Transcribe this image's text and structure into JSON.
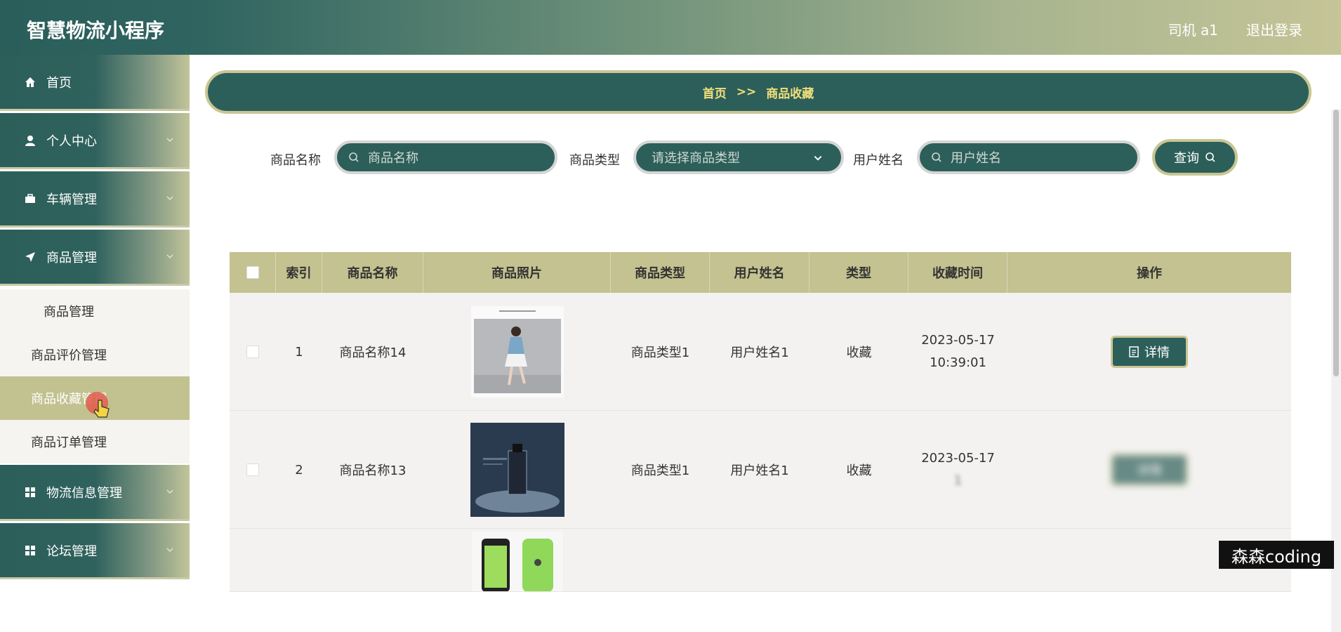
{
  "app": {
    "title": "智慧物流小程序",
    "user": "司机 a1",
    "logout": "退出登录"
  },
  "sidebar": {
    "menus": [
      {
        "label": "首页",
        "icon": "home-icon"
      },
      {
        "label": "个人中心",
        "icon": "user-icon"
      },
      {
        "label": "车辆管理",
        "icon": "briefcase-icon"
      },
      {
        "label": "商品管理",
        "icon": "send-icon"
      },
      {
        "label": "物流信息管理",
        "icon": "grid-icon"
      },
      {
        "label": "论坛管理",
        "icon": "grid-icon"
      }
    ],
    "submenu": [
      "商品管理",
      "商品评价管理",
      "商品收藏管理",
      "商品订单管理"
    ]
  },
  "breadcrumb": {
    "home": "首页",
    "sep": ">>",
    "current": "商品收藏"
  },
  "filters": {
    "name_label": "商品名称",
    "name_placeholder": "商品名称",
    "type_label": "商品类型",
    "type_placeholder": "请选择商品类型",
    "user_label": "用户姓名",
    "user_placeholder": "用户姓名",
    "search": "查询"
  },
  "table": {
    "headers": [
      "索引",
      "商品名称",
      "商品照片",
      "商品类型",
      "用户姓名",
      "类型",
      "收藏时间",
      "操作"
    ],
    "rows": [
      {
        "index": "1",
        "name": "商品名称14",
        "type": "商品类型1",
        "user": "用户姓名1",
        "kind": "收藏",
        "date": "2023-05-17",
        "time": "10:39:01",
        "action": "详情"
      },
      {
        "index": "2",
        "name": "商品名称13",
        "type": "商品类型1",
        "user": "用户姓名1",
        "kind": "收藏",
        "date": "2023-05-17",
        "time": "",
        "action": "详情"
      }
    ]
  },
  "watermark": "森森coding"
}
